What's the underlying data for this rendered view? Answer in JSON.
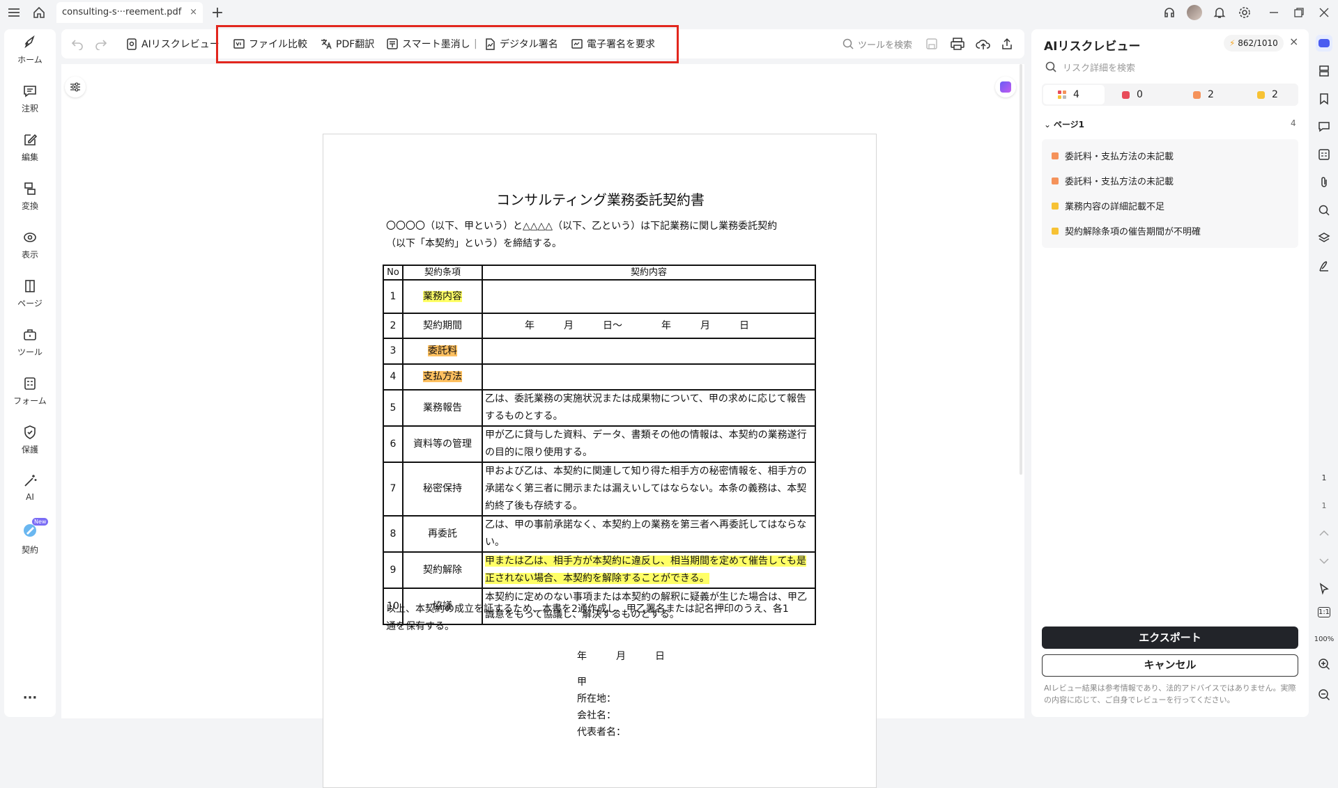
{
  "tab": {
    "title": "consulting-s···reement.pdf",
    "close": "×"
  },
  "nav": [
    {
      "label": "ホーム",
      "icon": "rocket-icon"
    },
    {
      "label": "注釈",
      "icon": "comment-icon"
    },
    {
      "label": "編集",
      "icon": "edit-icon"
    },
    {
      "label": "変換",
      "icon": "convert-icon"
    },
    {
      "label": "表示",
      "icon": "eye-icon"
    },
    {
      "label": "ページ",
      "icon": "pages-icon"
    },
    {
      "label": "ツール",
      "icon": "toolbox-icon"
    },
    {
      "label": "フォーム",
      "icon": "form-icon"
    },
    {
      "label": "保護",
      "icon": "shield-icon"
    },
    {
      "label": "AI",
      "icon": "magic-wand-icon"
    },
    {
      "label": "契約",
      "icon": "contract-icon",
      "badge": "New"
    }
  ],
  "nav_more": "···",
  "toolbar": {
    "ai_review": "AIリスクレビュー",
    "file_compare": "ファイル比較",
    "pdf_translate": "PDF翻訳",
    "smart_redact": "スマート墨消し",
    "digital_sign": "デジタル署名",
    "request_esign": "電子署名を要求",
    "search_placeholder": "ツールを検索"
  },
  "document": {
    "title": "コンサルティング業務委託契約書",
    "intro_line1": "〇〇〇〇（以下、甲という）と△△△△（以下、乙という）は下記業務に関し業務委託契約",
    "intro_line2": "（以下「本契約」という）を締結する。",
    "table_headers": {
      "no": "No",
      "item": "契約条項",
      "content": "契約内容"
    },
    "rows": [
      {
        "no": "1",
        "item": "業務内容",
        "content": ""
      },
      {
        "no": "2",
        "item": "契約期間",
        "content": "年　　　月　　　日～　　　　年　　　月　　　日"
      },
      {
        "no": "3",
        "item": "委託料",
        "content": ""
      },
      {
        "no": "4",
        "item": "支払方法",
        "content": ""
      },
      {
        "no": "5",
        "item": "業務報告",
        "content": "乙は、委託業務の実施状況または成果物について、甲の求めに応じて報告するものとする。"
      },
      {
        "no": "6",
        "item": "資料等の管理",
        "content": "甲が乙に貸与した資料、データ、書類その他の情報は、本契約の業務遂行の目的に限り使用する。"
      },
      {
        "no": "7",
        "item": "秘密保持",
        "content": "甲および乙は、本契約に関連して知り得た相手方の秘密情報を、相手方の承諾なく第三者に開示または漏えいしてはならない。本条の義務は、本契約終了後も存続する。"
      },
      {
        "no": "8",
        "item": "再委託",
        "content": "乙は、甲の事前承諾なく、本契約上の業務を第三者へ再委託してはならない。"
      },
      {
        "no": "9",
        "item": "契約解除",
        "content": "甲または乙は、相手方が本契約に違反し、相当期間を定めて催告しても是正されない場合、本契約を解除することができる。"
      },
      {
        "no": "10",
        "item": "協議",
        "content": "本契約に定めのない事項または本契約の解釈に疑義が生じた場合は、甲乙誠意をもって協議し、解決するものとする。"
      }
    ],
    "closing_line1": "以上、本契約の成立を証するため、本書を2通作成し、甲乙署名または記名押印のうえ、各1",
    "closing_line2": "通を保有する。",
    "date_line": "年　　　月　　　日",
    "party": "甲",
    "address": "所在地：",
    "company": "会社名：",
    "rep": "代表者名："
  },
  "review_panel": {
    "title": "AIリスクレビュー",
    "credits": "862/1010",
    "search_placeholder": "リスク詳細を検索",
    "counts": [
      {
        "value": "4",
        "kind": "all"
      },
      {
        "value": "0",
        "color": "#e84c5a"
      },
      {
        "value": "2",
        "color": "#f5925a"
      },
      {
        "value": "2",
        "color": "#f7c234"
      }
    ],
    "section_label": "ページ1",
    "section_count": "4",
    "items": [
      {
        "label": "委託料・支払方法の未記載",
        "color": "#f5925a"
      },
      {
        "label": "委託料・支払方法の未記載",
        "color": "#f5925a"
      },
      {
        "label": "業務内容の詳細記載不足",
        "color": "#f7c234"
      },
      {
        "label": "契約解除条項の催告期間が不明確",
        "color": "#f7c234"
      }
    ],
    "export": "エクスポート",
    "cancel": "キャンセル",
    "disclaimer": "AIレビュー結果は参考情報であり、法的アドバイスではありません。実際の内容に応じて、ご自身でレビューを行ってください。"
  },
  "page_nav": {
    "current": "1",
    "total": "1",
    "zoom": "100%",
    "ratio": "1:1"
  }
}
